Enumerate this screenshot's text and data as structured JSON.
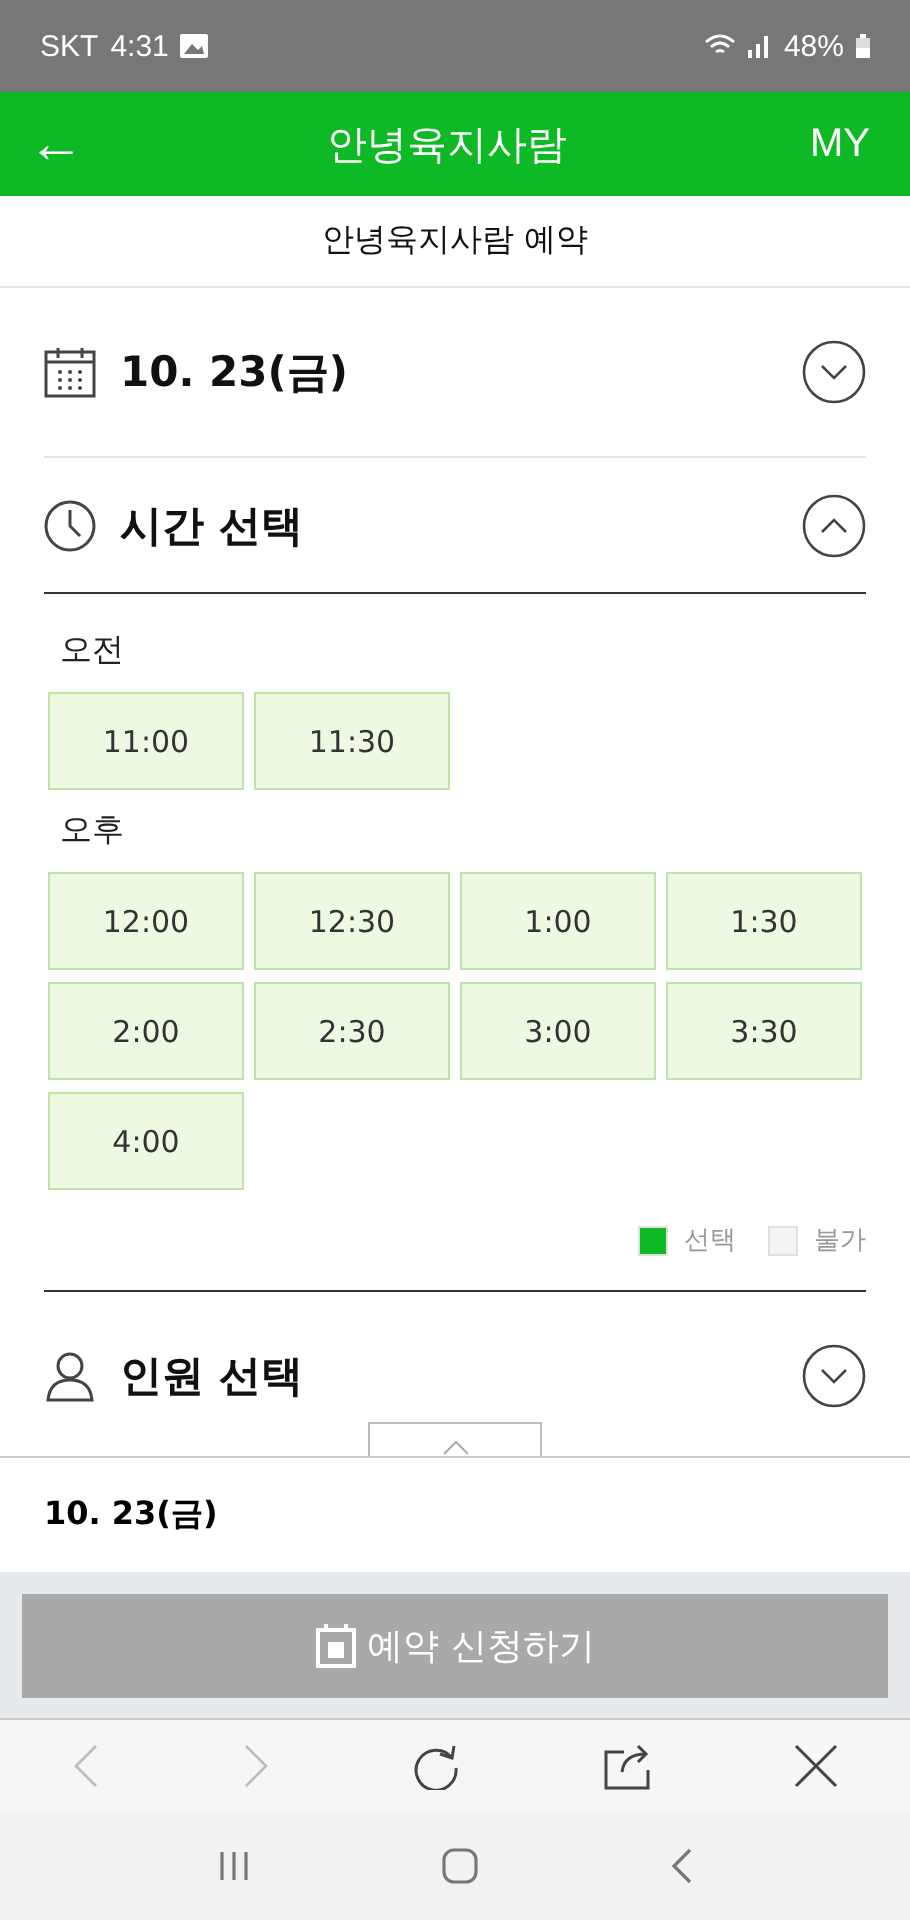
{
  "status_bar": {
    "carrier": "SKT",
    "time": "4:31",
    "battery": "48%"
  },
  "header": {
    "back": "←",
    "title": "안녕육지사람",
    "my": "MY"
  },
  "subtitle": "안녕육지사람 예약",
  "date_section": {
    "title": "10. 23(금)",
    "expanded": false
  },
  "time_section": {
    "title": "시간 선택",
    "expanded": true,
    "groups": [
      {
        "label": "오전",
        "slots": [
          {
            "time": "11:00",
            "selected": false,
            "disabled": false
          },
          {
            "time": "11:30",
            "selected": false,
            "disabled": false
          }
        ]
      },
      {
        "label": "오후",
        "slots": [
          {
            "time": "12:00",
            "selected": false,
            "disabled": false
          },
          {
            "time": "12:30",
            "selected": false,
            "disabled": false
          },
          {
            "time": "1:00",
            "selected": false,
            "disabled": false
          },
          {
            "time": "1:30",
            "selected": false,
            "disabled": false
          },
          {
            "time": "2:00",
            "selected": false,
            "disabled": false
          },
          {
            "time": "2:30",
            "selected": false,
            "disabled": false
          },
          {
            "time": "3:00",
            "selected": false,
            "disabled": false
          },
          {
            "time": "3:30",
            "selected": false,
            "disabled": false
          },
          {
            "time": "4:00",
            "selected": false,
            "disabled": false
          }
        ]
      }
    ],
    "legend": [
      {
        "label": "선택",
        "color": "#0db924"
      },
      {
        "label": "불가",
        "color": "#f4f4f4"
      }
    ]
  },
  "people_section": {
    "title": "인원 선택",
    "expanded": false
  },
  "summary": {
    "date": "10. 23(금)"
  },
  "submit_button": {
    "label": "예약 신청하기",
    "disabled": true
  }
}
